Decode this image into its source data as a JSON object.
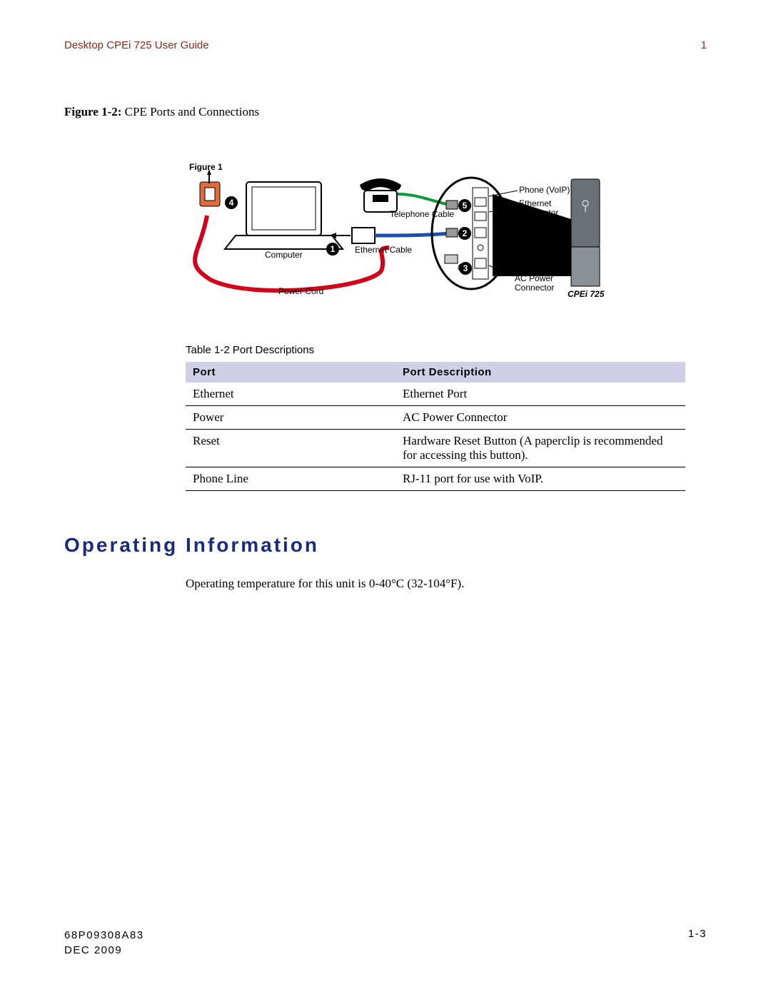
{
  "header": {
    "title": "Desktop CPEi 725 User Guide",
    "chapter_num": "1"
  },
  "figure": {
    "label": "Figure 1-2:",
    "caption": " CPE Ports and Connections"
  },
  "diagram": {
    "figure_label": "Figure 1",
    "labels": {
      "computer": "Computer",
      "power_cord": "Power Cord",
      "ethernet_cable": "Ethernet Cable",
      "telephone_cable": "Telephone Cable",
      "phone_voip": "Phone (VoIP)",
      "ethernet_connector": "Ethernet\nConnector",
      "ac_power_connector": "AC Power\nConnector",
      "device": "CPEi 725"
    },
    "badges": {
      "1": "1",
      "2": "2",
      "3": "3",
      "4": "4",
      "5": "5"
    }
  },
  "table": {
    "caption": "Table 1-2 Port Descriptions",
    "headers": {
      "port": "Port",
      "desc": "Port Description"
    },
    "rows": [
      {
        "port": "Ethernet",
        "desc": "Ethernet Port"
      },
      {
        "port": "Power",
        "desc": "AC Power Connector"
      },
      {
        "port": "Reset",
        "desc": "Hardware Reset Button (A paperclip is recommended for accessing this button)."
      },
      {
        "port": "Phone Line",
        "desc": "RJ-11 port for use with VoIP."
      }
    ]
  },
  "section": {
    "heading": "Operating Information",
    "body": "Operating temperature for this unit is 0-40°C (32-104°F)."
  },
  "footer": {
    "docnum": "68P09308A83",
    "date": "DEC 2009",
    "pagenum": "1-3"
  }
}
